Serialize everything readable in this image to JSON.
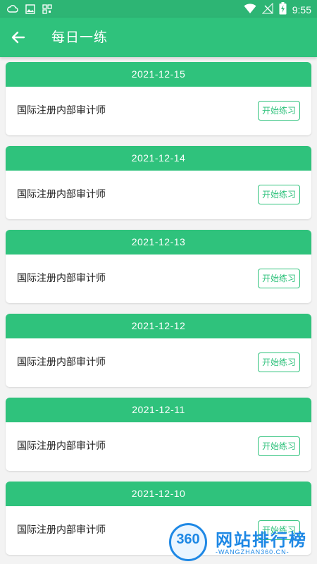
{
  "status_bar": {
    "time": "9:55",
    "icons": [
      "cloud-icon",
      "image-icon",
      "qr-icon",
      "wifi-icon",
      "no-signal-icon",
      "battery-charging-icon"
    ]
  },
  "header": {
    "title": "每日一练",
    "back_icon": "arrow-left-icon"
  },
  "items": [
    {
      "date": "2021-12-15",
      "title": "国际注册内部审计师",
      "button": "开始练习"
    },
    {
      "date": "2021-12-14",
      "title": "国际注册内部审计师",
      "button": "开始练习"
    },
    {
      "date": "2021-12-13",
      "title": "国际注册内部审计师",
      "button": "开始练习"
    },
    {
      "date": "2021-12-12",
      "title": "国际注册内部审计师",
      "button": "开始练习"
    },
    {
      "date": "2021-12-11",
      "title": "国际注册内部审计师",
      "button": "开始练习"
    },
    {
      "date": "2021-12-10",
      "title": "国际注册内部审计师",
      "button": "开始练习"
    }
  ],
  "watermark": {
    "number": "360",
    "text": "网站排行榜",
    "sub": "-WANGZHAN360.CN-"
  },
  "colors": {
    "primary": "#2fc27c",
    "status_bar": "#2db574",
    "background": "#f3f3f3",
    "watermark": "#1e88e5"
  }
}
